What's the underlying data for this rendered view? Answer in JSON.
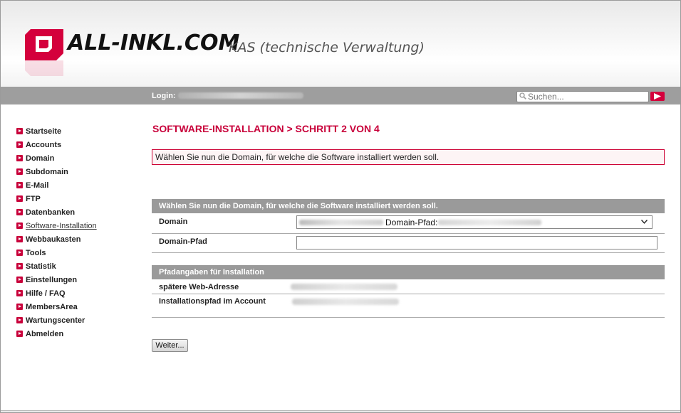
{
  "header": {
    "brand": "ALL-INKL.COM",
    "tagline": "KAS (technische Verwaltung)"
  },
  "topbar": {
    "login_label": "Login:",
    "search_placeholder": "Suchen..."
  },
  "sidebar": {
    "items": [
      {
        "label": "Startseite"
      },
      {
        "label": "Accounts"
      },
      {
        "label": "Domain"
      },
      {
        "label": "Subdomain"
      },
      {
        "label": "E-Mail"
      },
      {
        "label": "FTP"
      },
      {
        "label": "Datenbanken"
      },
      {
        "label": "Software-Installation"
      },
      {
        "label": "Webbaukasten"
      },
      {
        "label": "Tools"
      },
      {
        "label": "Statistik"
      },
      {
        "label": "Einstellungen"
      },
      {
        "label": "Hilfe / FAQ"
      },
      {
        "label": "MembersArea"
      },
      {
        "label": "Wartungscenter"
      },
      {
        "label": "Abmelden"
      }
    ]
  },
  "main": {
    "title": "SOFTWARE-INSTALLATION > SCHRITT 2 VON 4",
    "notice": "Wählen Sie nun die Domain, für welche die Software installiert werden soll.",
    "section1": {
      "heading": "Wählen Sie nun die Domain, für welche die Software installiert werden soll.",
      "domain_label": "Domain",
      "domain_select_text": "Domain-Pfad:",
      "domain_path_label": "Domain-Pfad",
      "domain_path_value": ""
    },
    "section2": {
      "heading": "Pfadangaben für Installation",
      "web_address_label": "spätere Web-Adresse",
      "install_path_label": "Installationspfad im Account"
    },
    "submit_label": "Weiter..."
  },
  "colors": {
    "accent": "#c8003a",
    "bar_gray": "#9e9e9e"
  }
}
